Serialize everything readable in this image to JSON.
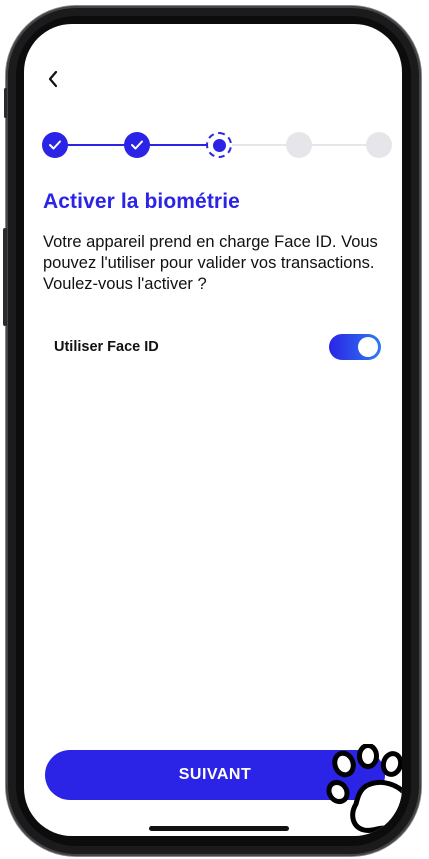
{
  "nav": {
    "back_icon": "chevron-left-icon"
  },
  "stepper": {
    "steps": [
      {
        "state": "done"
      },
      {
        "state": "done"
      },
      {
        "state": "current"
      },
      {
        "state": "todo"
      },
      {
        "state": "todo"
      }
    ]
  },
  "content": {
    "title": "Activer la biométrie",
    "description": "Votre appareil prend en charge Face ID. Vous pouvez l'utiliser pour valider vos transactions. Voulez-vous l'activer ?"
  },
  "face_id": {
    "label": "Utiliser Face ID",
    "enabled": true
  },
  "footer": {
    "next_label": "SUIVANT"
  },
  "colors": {
    "primary": "#2b24e6",
    "toggle_end": "#2e7bf0",
    "inactive_step": "#e6e6ea"
  }
}
